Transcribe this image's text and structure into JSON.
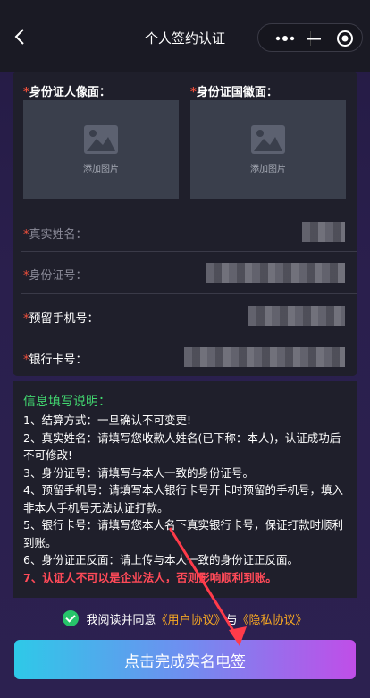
{
  "nav": {
    "title": "个人签约认证",
    "back_icon": "back-arrow-icon",
    "more_icon": "more-dots-icon",
    "minimize_icon": "minimize-icon",
    "close_icon": "target-close-icon"
  },
  "uploads": [
    {
      "label": "身份证人像面：",
      "required": "*",
      "placeholder": "添加图片",
      "icon": "image-icon"
    },
    {
      "label": "身份证国徽面：",
      "required": "*",
      "placeholder": "添加图片",
      "icon": "image-icon"
    }
  ],
  "fields": [
    {
      "label": "真实姓名：",
      "required": "*"
    },
    {
      "label": "身份证号：",
      "required": "*"
    },
    {
      "label": "预留手机号：",
      "required": "*"
    },
    {
      "label": "银行卡号：",
      "required": "*"
    }
  ],
  "info": {
    "title": "信息填写说明：",
    "lines": [
      "1、结算方式：一旦确认不可变更!",
      "2、真实姓名：请填写您收款人姓名(已下称：本人)，认证成功后不可修改!",
      "3、身份证号：请填写与本人一致的身份证号。",
      "4、预留手机号：请填写本人银行卡号开卡时预留的手机号，填入非本人手机号无法认证打款。",
      "5、银行卡号：请填写您本人名下真实银行卡号，保证打款时顺利到账。",
      "6、身份证正反面：请上传与本人一致的身份证正反面。"
    ],
    "warning": "7、认证人不可以是企业法人，否则影响顺利到账。"
  },
  "agreement": {
    "prefix": "我阅读并同意",
    "user_link": "《用户协议》",
    "and": "与",
    "privacy_link": "《隐私协议》"
  },
  "submit_label": "点击完成实名电签",
  "colors": {
    "accent_green": "#42d870",
    "warning_red": "#ff4a58",
    "link_orange": "#f5a623"
  }
}
